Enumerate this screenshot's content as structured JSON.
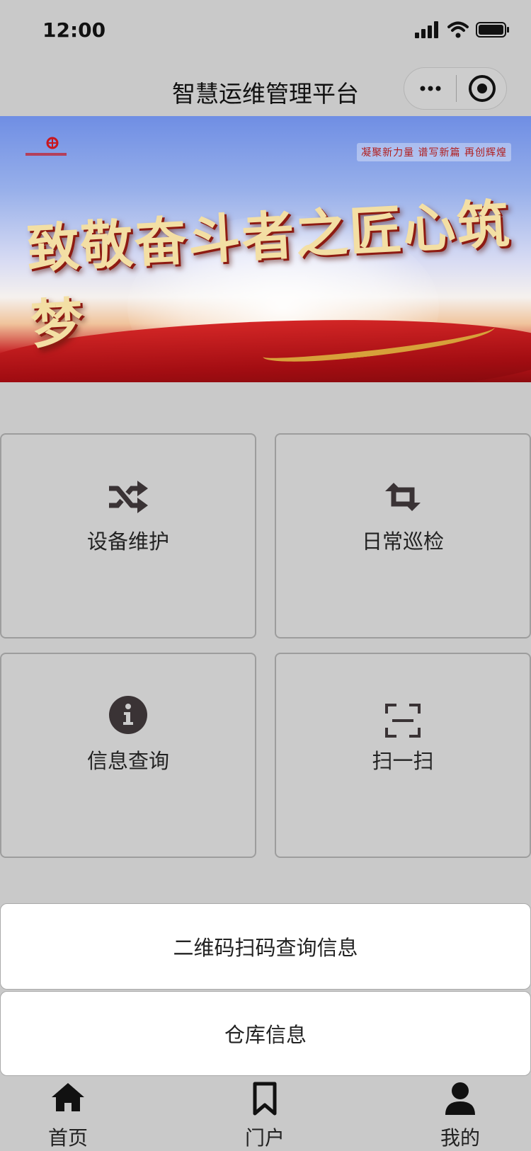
{
  "status_bar": {
    "time": "12:00",
    "icons": [
      "signal-icon",
      "wifi-icon",
      "battery-icon"
    ]
  },
  "nav": {
    "title": "智慧运维管理平台",
    "capsule": {
      "more_icon": "more-dots-icon",
      "close_icon": "target-close-icon"
    }
  },
  "banner": {
    "title_text": "致敬奋斗者之匠心筑梦",
    "slogan_text": "凝聚新力量 谱写新篇 再创辉煌"
  },
  "grid": [
    {
      "label": "设备维护",
      "icon": "shuffle-icon"
    },
    {
      "label": "日常巡检",
      "icon": "retweet-icon"
    },
    {
      "label": "信息查询",
      "icon": "info-circle-icon"
    },
    {
      "label": "扫一扫",
      "icon": "scan-icon"
    }
  ],
  "actions": [
    {
      "label": "二维码扫码查询信息"
    },
    {
      "label": "仓库信息"
    }
  ],
  "tabbar": [
    {
      "label": "首页",
      "icon": "home-icon"
    },
    {
      "label": "门户",
      "icon": "bookmark-icon"
    },
    {
      "label": "我的",
      "icon": "user-icon"
    }
  ],
  "colors": {
    "background": "#c9c9c9",
    "icon": "#3a3335",
    "card_border": "#9d9d9d",
    "button_bg": "#ffffff"
  }
}
